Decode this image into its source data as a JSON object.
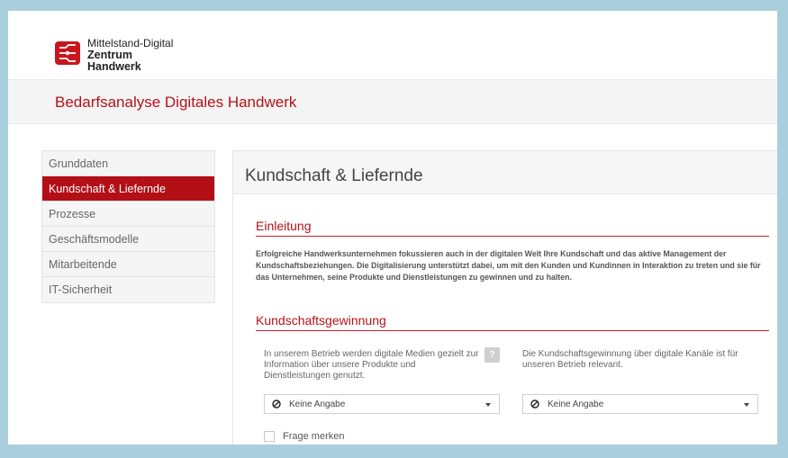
{
  "brand": {
    "line1": "Mittelstand-Digital",
    "line2": "Zentrum",
    "line3": "Handwerk"
  },
  "app": {
    "title": "Bedarfsanalyse Digitales Handwerk"
  },
  "sidebar": {
    "items": [
      {
        "label": "Grunddaten"
      },
      {
        "label": "Kundschaft & Liefernde"
      },
      {
        "label": "Prozesse"
      },
      {
        "label": "Geschäftsmodelle"
      },
      {
        "label": "Mitarbeitende"
      },
      {
        "label": "IT-Sicherheit"
      }
    ]
  },
  "main": {
    "title": "Kundschaft & Liefernde",
    "intro_heading": "Einleitung",
    "intro_text": "Erfolgreiche Handwerksunternehmen fokussieren auch in der digitalen Welt Ihre Kundschaft und das aktive Management der Kundschaftsbeziehungen. Die Digitalisierung unterstützt dabei, um mit den Kunden und Kundinnen in Interaktion zu treten und sie für das Unternehmen, seine Produkte und Dienstleistungen zu gewinnen und zu halten.",
    "section_heading": "Kundschaftsgewinnung",
    "question1": "In unserem Betrieb werden digitale Medien gezielt zur Information über unsere Produkte und Dienstleistungen genutzt.",
    "question2": "Die Kundschaftsgewinnung über digitale Kanäle ist für unseren Betrieb relevant.",
    "help": "?",
    "select1": "Keine Angabe",
    "select2": "Keine Angabe",
    "remember": "Frage merken"
  },
  "colors": {
    "accent": "#b30f16",
    "frame": "#a9cfdd"
  }
}
